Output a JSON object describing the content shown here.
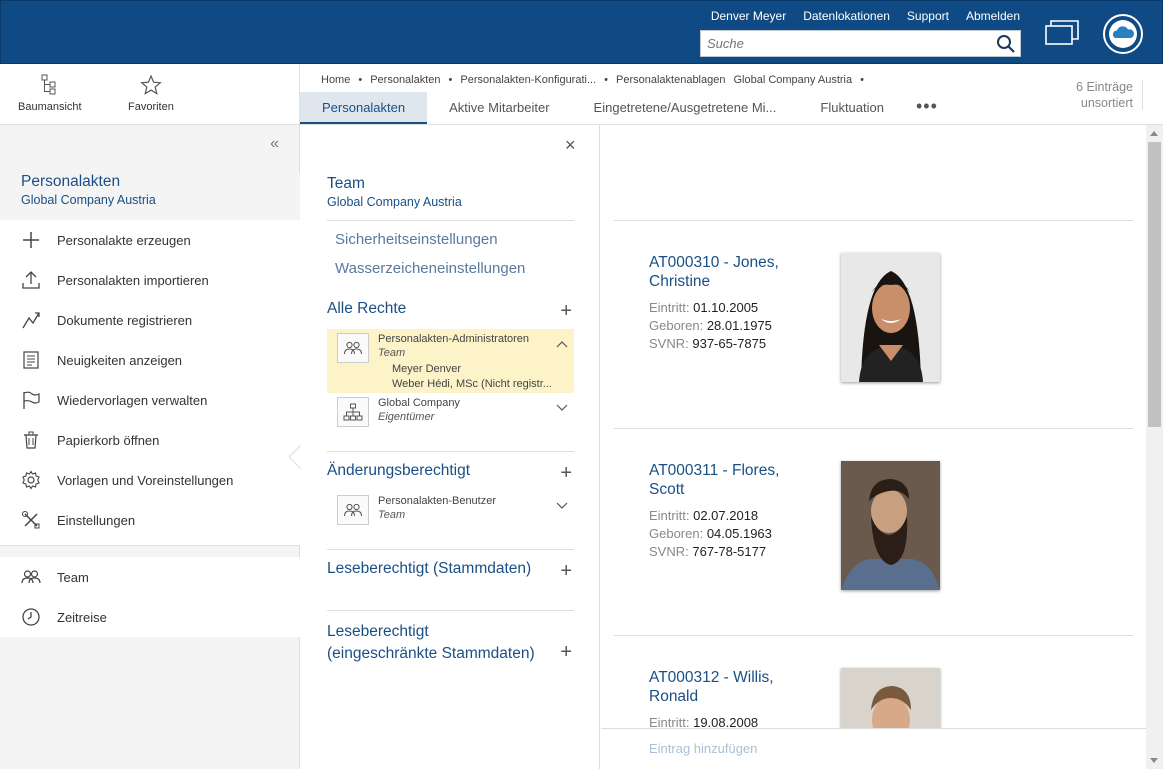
{
  "header": {
    "user": "Denver Meyer",
    "links": [
      "Datenlokationen",
      "Support",
      "Abmelden"
    ],
    "search_placeholder": "Suche"
  },
  "toolbar": {
    "tree_view": "Baumansicht",
    "favorites": "Favoriten"
  },
  "breadcrumb": [
    "Home",
    "Personalakten",
    "Personalakten-Konfigurati...",
    "Personalaktenablagen",
    "Global Company Austria"
  ],
  "tabs": [
    "Personalakten",
    "Aktive Mitarbeiter",
    "Eingetretene/Ausgetretene Mi...",
    "Fluktuation"
  ],
  "tabs_more": "•••",
  "entries": {
    "count": "6 Einträge",
    "sort": "unsortiert"
  },
  "leftnav": {
    "collapse": "«",
    "title": "Personalakten",
    "subtitle": "Global Company Austria",
    "items": [
      {
        "label": "Personalakte erzeugen",
        "icon": "plus-icon"
      },
      {
        "label": "Personalakten importieren",
        "icon": "upload-icon"
      },
      {
        "label": "Dokumente registrieren",
        "icon": "register-icon"
      },
      {
        "label": "Neuigkeiten anzeigen",
        "icon": "news-icon"
      },
      {
        "label": "Wiedervorlagen verwalten",
        "icon": "flag-icon"
      },
      {
        "label": "Papierkorb öffnen",
        "icon": "trash-icon"
      },
      {
        "label": "Vorlagen und Voreinstellungen",
        "icon": "gear-icon"
      },
      {
        "label": "Einstellungen",
        "icon": "tools-icon"
      }
    ],
    "items2": [
      {
        "label": "Team",
        "icon": "team-icon"
      },
      {
        "label": "Zeitreise",
        "icon": "clock-icon"
      }
    ]
  },
  "team_panel": {
    "close": "×",
    "title": "Team",
    "subtitle": "Global Company Austria",
    "links": [
      "Sicherheitseinstellungen",
      "Wasserzeicheneinstellungen"
    ],
    "sections": {
      "all_rights": "Alle Rechte",
      "change": "Änderungsberechtigt",
      "read_master": "Leseberechtigt (Stammdaten)",
      "read_limited_1": "Leseberechtigt",
      "read_limited_2": "(eingeschränkte Stammdaten)"
    },
    "groups": {
      "admins": {
        "name": "Personalakten-Administratoren",
        "role": "Team",
        "members": [
          "Meyer Denver",
          "Weber Hédi, MSc (Nicht registr..."
        ]
      },
      "company": {
        "name": "Global Company",
        "role": "Eigentümer"
      },
      "users": {
        "name": "Personalakten-Benutzer",
        "role": "Team"
      }
    },
    "highlight_color": "#fcf3c8"
  },
  "records": [
    {
      "title": "AT000310 - Jones, Christine",
      "entry_label": "Eintritt:",
      "entry": "01.10.2005",
      "born_label": "Geboren:",
      "born": "28.01.1975",
      "ssn_label": "SVNR:",
      "ssn": "937-65-7875"
    },
    {
      "title": "AT000311 - Flores, Scott",
      "entry_label": "Eintritt:",
      "entry": "02.07.2018",
      "born_label": "Geboren:",
      "born": "04.05.1963",
      "ssn_label": "SVNR:",
      "ssn": "767-78-5177"
    },
    {
      "title": "AT000312 - Willis, Ronald",
      "entry_label": "Eintritt:",
      "entry": "19.08.2008"
    }
  ],
  "add_entry": "Eintrag hinzufügen",
  "colors": {
    "header_bg": "#0f4a85",
    "accent": "#1a4f86",
    "tab_active_bg": "#dfe6ee"
  }
}
